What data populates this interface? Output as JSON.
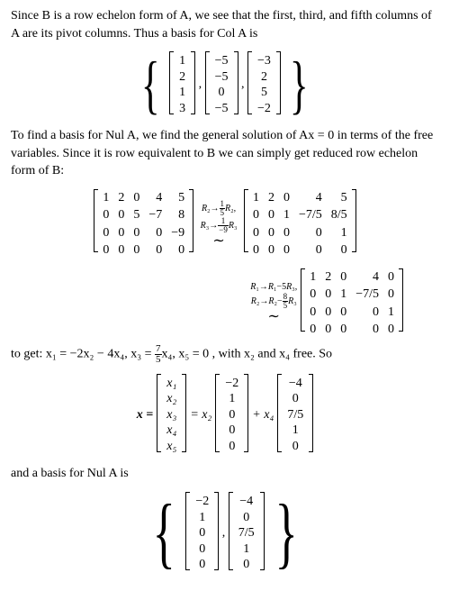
{
  "para1": "Since B is a row echelon form of A, we see that the first, third, and fifth columns of A are its pivot columns. Thus a basis for Col A is",
  "basis_col": {
    "v1": [
      "1",
      "2",
      "1",
      "3"
    ],
    "v2": [
      "−5",
      "−5",
      "0",
      "−5"
    ],
    "v3": [
      "−3",
      "2",
      "5",
      "−2"
    ]
  },
  "para2": "To find a basis for Nul A, we find the general solution of Ax = 0 in terms of the free variables. Since it is row equivalent to B we can simply get reduced row echelon form of B:",
  "matrixB": [
    [
      "1",
      "2",
      "0",
      "4",
      "5"
    ],
    [
      "0",
      "0",
      "5",
      "−7",
      "8"
    ],
    [
      "0",
      "0",
      "0",
      "0",
      "−9"
    ],
    [
      "0",
      "0",
      "0",
      "0",
      "0"
    ]
  ],
  "ops1_a": "R₂→⅕R₂,",
  "ops1_b": "R₃→(1/−9)R₃",
  "matrixB2": [
    [
      "1",
      "2",
      "0",
      "4",
      "5"
    ],
    [
      "0",
      "0",
      "1",
      "−7/5",
      "8/5"
    ],
    [
      "0",
      "0",
      "0",
      "0",
      "1"
    ],
    [
      "0",
      "0",
      "0",
      "0",
      "0"
    ]
  ],
  "ops2_a": "R₁→R₁−5R₃,",
  "ops2_b": "R₂→R₂−⁸⁄₅R₃",
  "matrixB3": [
    [
      "1",
      "2",
      "0",
      "4",
      "0"
    ],
    [
      "0",
      "0",
      "1",
      "−7/5",
      "0"
    ],
    [
      "0",
      "0",
      "0",
      "0",
      "1"
    ],
    [
      "0",
      "0",
      "0",
      "0",
      "0"
    ]
  ],
  "para3_a": "to get: x₁ = −2x₂ − 4x₄,  x₃ = ",
  "para3_frac_num": "7",
  "para3_frac_den": "5",
  "para3_b": "x₄, x₅ = 0 , with x₂ and x₄ free. So",
  "xvec_labels": [
    "x₁",
    "x₂",
    "x₃",
    "x₄",
    "x₅"
  ],
  "xvec_c1": [
    "−2",
    "1",
    "0",
    "0",
    "0"
  ],
  "xvec_c2": [
    "−4",
    "0",
    "7/5",
    "1",
    "0"
  ],
  "xvec_prefix": "x =",
  "xvec_eq": "= x₂",
  "xvec_plus": "+ x₄",
  "para4": "and a basis for Nul A is",
  "chart_data": {
    "type": "table",
    "title": "Row reduction of matrix B to RREF",
    "matrices": [
      [
        [
          1,
          2,
          0,
          4,
          5
        ],
        [
          0,
          0,
          5,
          -7,
          8
        ],
        [
          0,
          0,
          0,
          0,
          -9
        ],
        [
          0,
          0,
          0,
          0,
          0
        ]
      ],
      [
        [
          1,
          2,
          0,
          4,
          5
        ],
        [
          0,
          0,
          1,
          -1.4,
          1.6
        ],
        [
          0,
          0,
          0,
          0,
          1
        ],
        [
          0,
          0,
          0,
          0,
          0
        ]
      ],
      [
        [
          1,
          2,
          0,
          4,
          0
        ],
        [
          0,
          0,
          1,
          -1.4,
          0
        ],
        [
          0,
          0,
          0,
          0,
          1
        ],
        [
          0,
          0,
          0,
          0,
          0
        ]
      ]
    ],
    "col_basis": [
      [
        1,
        2,
        1,
        3
      ],
      [
        -5,
        -5,
        0,
        -5
      ],
      [
        -3,
        2,
        5,
        -2
      ]
    ],
    "nul_basis": [
      [
        -2,
        1,
        0,
        0,
        0
      ],
      [
        -4,
        0,
        1.4,
        1,
        0
      ]
    ]
  }
}
